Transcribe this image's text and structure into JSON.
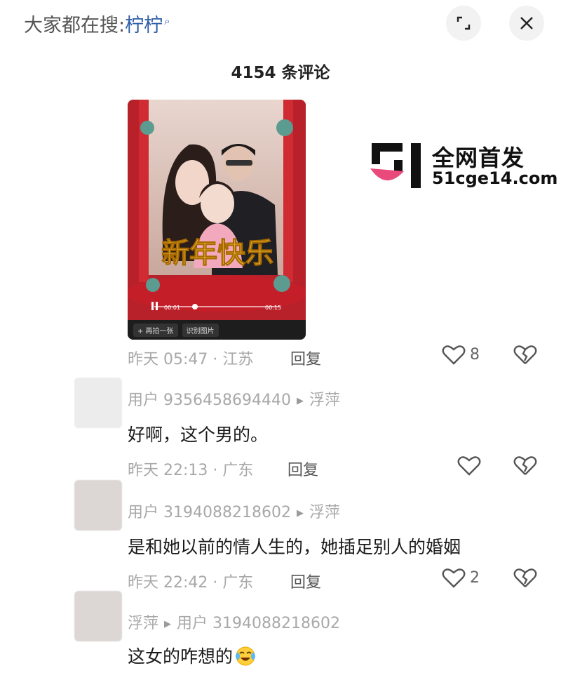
{
  "header": {
    "search_prefix": "大家都在搜:",
    "search_keyword": "柠柠",
    "search_icon": "search-icon",
    "expand_icon": "expand-icon",
    "close_icon": "close-icon"
  },
  "comments_header": {
    "count_label": "4154 条评论"
  },
  "video": {
    "banner_text": "新年快乐",
    "time_left": "00:01",
    "time_right": "00:15",
    "chip_1": "+ 再拍一张",
    "chip_2": "识别图片"
  },
  "watermark": {
    "line1": "全网首发",
    "line2": "51cge14.com"
  },
  "comments": [
    {
      "time_location": "昨天 05:47 · 江苏",
      "reply_label": "回复",
      "likes": "8"
    },
    {
      "user": "用户 9356458694440",
      "reply_to": "浮萍",
      "text": "好啊，这个男的。",
      "time_location": "昨天 22:13 · 广东",
      "reply_label": "回复",
      "likes": ""
    },
    {
      "user": "用户 3194088218602",
      "reply_to": "浮萍",
      "text": "是和她以前的情人生的，她插足别人的婚姻",
      "time_location": "昨天 22:42 · 广东",
      "reply_label": "回复",
      "likes": "2"
    },
    {
      "user": "浮萍",
      "reply_to": "用户 3194088218602",
      "text": "这女的咋想的"
    }
  ],
  "colors": {
    "accent_link": "#2f5ea8",
    "meta_gray": "#a8a8a8",
    "watermark_pink": "#e94a7b"
  }
}
